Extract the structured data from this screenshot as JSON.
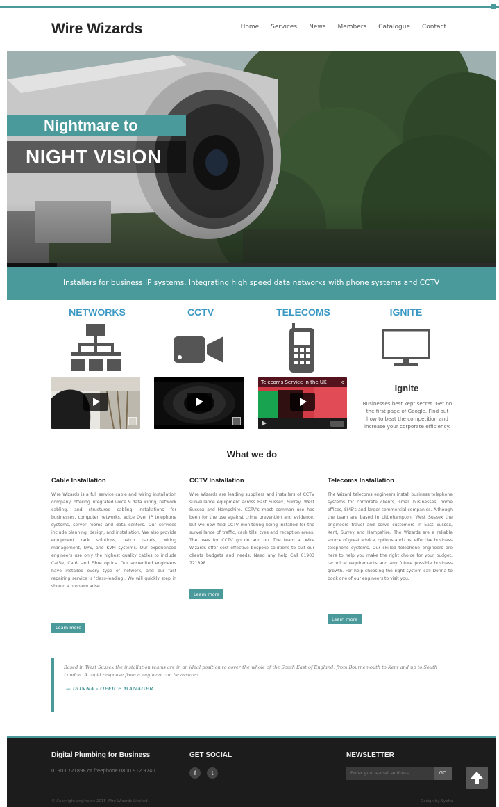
{
  "header": {
    "logo": "Wire Wizards",
    "nav": [
      "Home",
      "Services",
      "News",
      "Members",
      "Catalogue",
      "Contact"
    ]
  },
  "hero": {
    "line1": "Nightmare to",
    "line2": "NIGHT VISION"
  },
  "tagline": "Installers for business IP systems. Integrating high speed data networks with phone systems and CCTV",
  "services": [
    {
      "title": "NETWORKS"
    },
    {
      "title": "CCTV"
    },
    {
      "title": "TELECOMS",
      "video_title": "Telecoms Service in the UK"
    },
    {
      "title": "IGNITE"
    }
  ],
  "ignite": {
    "heading": "Ignite",
    "text": "Businesses best kept secret. Get on the first page of Google. Find out how to beat the competition and increase your corporate efficiency."
  },
  "what_we_do": "What we do",
  "columns": [
    {
      "heading": "Cable Installation",
      "text": "Wire Wizards is a full service cable and wiring installation company, offering integrated voice & data wiring, network cabling, and structured cabling installations for businesses, computer networks, Voice Over IP telephone systems, server rooms and data centers. Our services include planning, design, and installation. We also provide equipment rack solutions, patch panels, wiring management, UPS, and KVM systems. Our experienced engineers use only the highest quality cables to include Cat5e, Cat6, and Fibre optics. Our accredited engineers have installed every type of network, and our fast repairing service is 'class-leading'. We will quickly step in should a problem arise.",
      "button": "Learn more"
    },
    {
      "heading": "CCTV Installation",
      "text": "Wire Wizards are leading suppliers and installers of CCTV surveillance equipment across East Sussex, Surrey, West Sussex and Hampshire. CCTV's most common use has been for the use against crime prevention and evidence, but we now find CCTV monitoring being installed for the surveillance of traffic, cash tills, tves and reception areas. The uses for CCTV go on and on. The team at Wire Wizards offer cost effective bespoke solutions to suit our clients budgets and needs. Need any help Call 01903 721898",
      "button": "Learn more"
    },
    {
      "heading": "Telecoms Installation",
      "text": "The Wizard telecoms engineers install business telephone systems for corporate clients, small businesses, home offices, SME's and larger commercial companies. Although the team are based in Littlehampton, West Sussex the engineers travel and serve customers in East Sussex, Kent, Surrey and Hampshire. The Wizards are a reliable source of great advice, options and cost effective business telephone systems. Our skilled telephone engineers are here to help you make the right choice for your budget, technical requirements and any future possible business growth. For help choosing the right system call Donna to book one of our engineers to visit you.",
      "button": "Learn more"
    }
  ],
  "quote": {
    "text": "Based in West Sussex the installation teams are in an ideal position to cover the whole of the South East of England, from Bournemouth to Kent and up to South London. A rapid response from a engineer can be assured.",
    "author": "— DONNA - OFFICE MANAGER"
  },
  "footer": {
    "col1_heading": "Digital Plumbing for Business",
    "col1_text": "01903 721898 or freephone 0800 912 9740",
    "col2_heading": "GET SOCIAL",
    "social": [
      "f",
      "t"
    ],
    "col3_heading": "NEWSLETTER",
    "newsletter_placeholder": "Enter your e-mail address...",
    "newsletter_button": "GO",
    "copyright": "© Copyright engineers 2015 Wire Wizards Limited",
    "credit": "Design by Sypha"
  }
}
